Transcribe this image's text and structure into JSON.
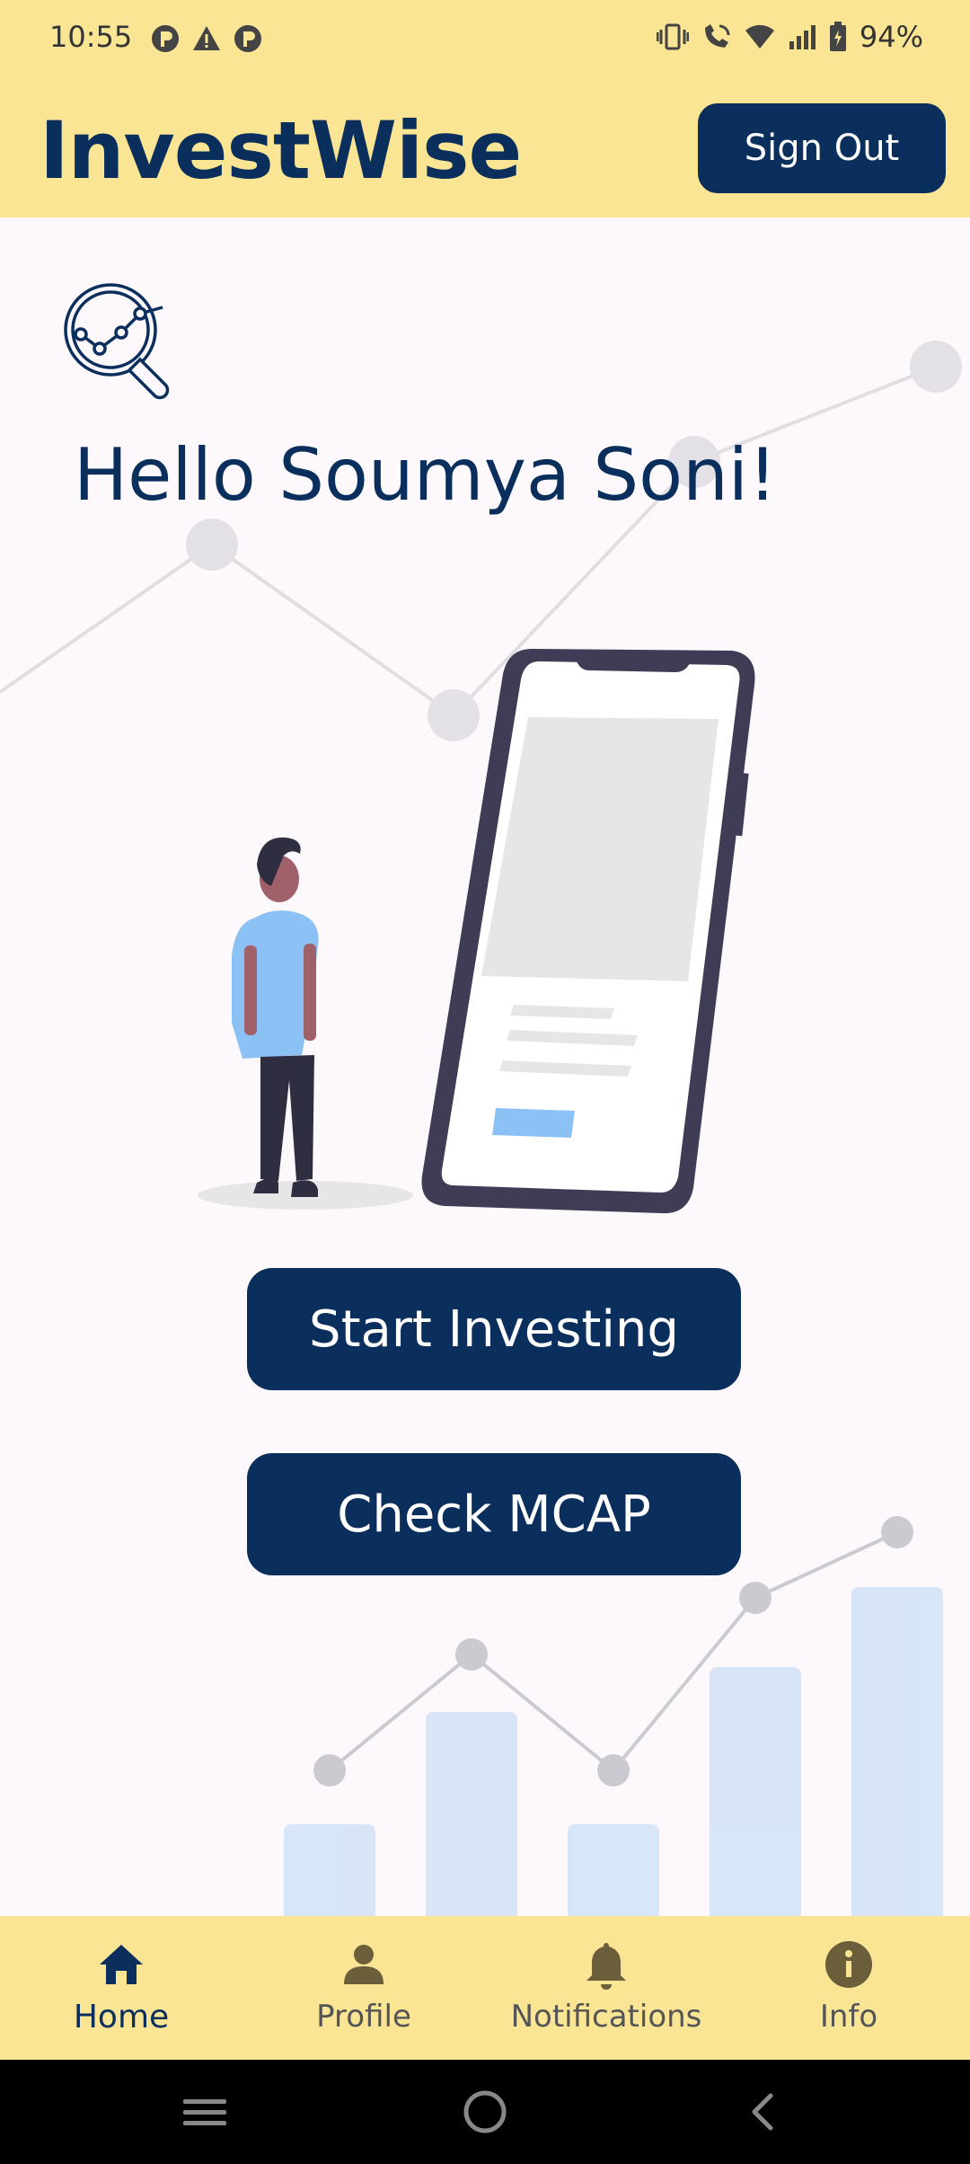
{
  "status_bar": {
    "time": "10:55",
    "battery": "94%",
    "left_icons": [
      "p-icon",
      "warning-icon",
      "p-icon"
    ],
    "right_icons": [
      "vibrate-icon",
      "wifi-call-icon",
      "wifi-icon",
      "signal-icon",
      "battery-icon"
    ]
  },
  "header": {
    "title": "InvestWise",
    "sign_out_label": "Sign Out"
  },
  "main": {
    "greeting": "Hello Soumya Soni!",
    "start_investing_label": "Start Investing",
    "check_mcap_label": "Check MCAP"
  },
  "bottom_nav": {
    "items": [
      {
        "label": "Home",
        "icon": "home-icon",
        "active": true
      },
      {
        "label": "Profile",
        "icon": "person-icon",
        "active": false
      },
      {
        "label": "Notifications",
        "icon": "bell-icon",
        "active": false
      },
      {
        "label": "Info",
        "icon": "info-icon",
        "active": false
      }
    ]
  },
  "colors": {
    "primary": "#0a2f5c",
    "header_bg": "#f9e594",
    "page_bg": "#fdf8fb",
    "bar_fill": "#d3e3f7"
  }
}
